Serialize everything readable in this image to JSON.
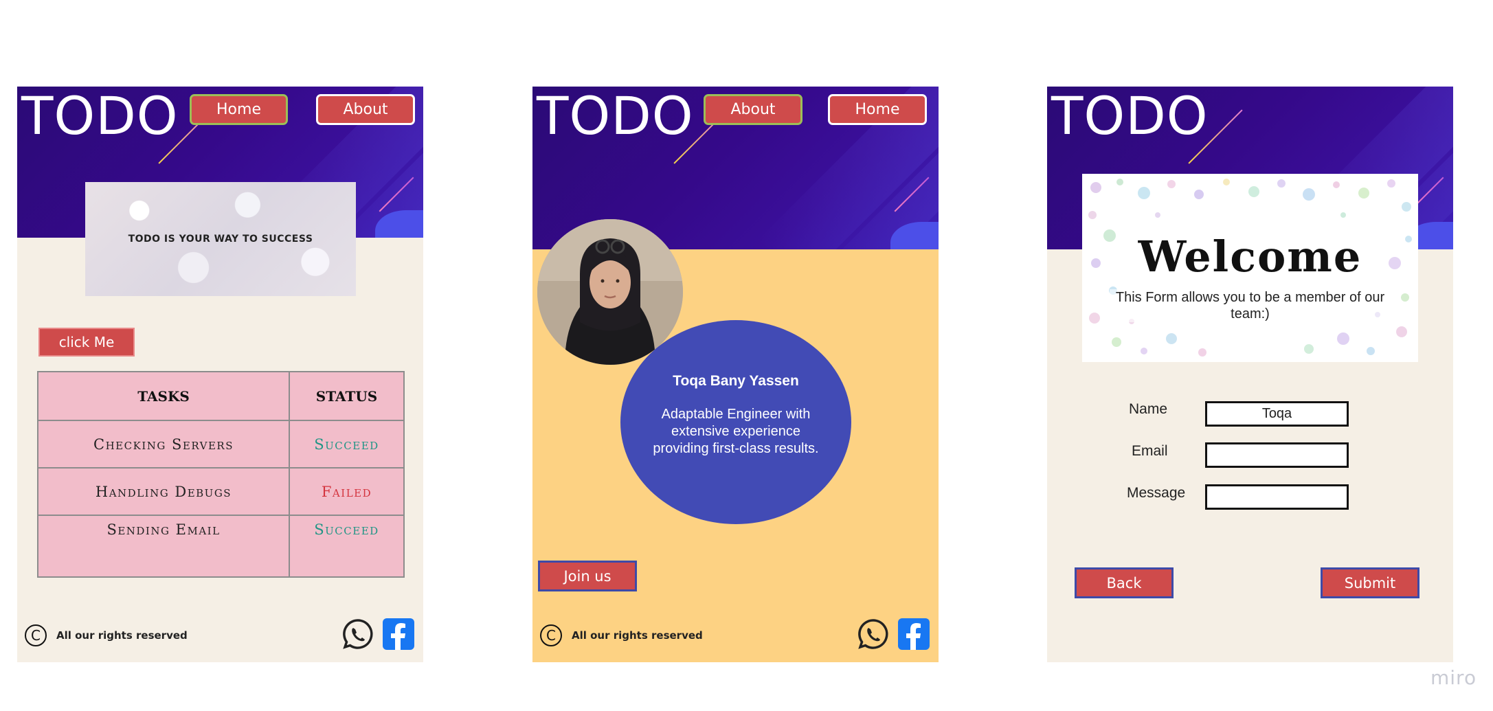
{
  "brand": {
    "logo": "TODO",
    "accent": "#cf4b4b",
    "header_color": "#35098a"
  },
  "home_page": {
    "nav": {
      "home": "Home",
      "about": "About"
    },
    "hero_text": "TODO IS YOUR WAY TO SUCCESS",
    "click_button": "click Me",
    "table": {
      "headers": [
        "TASKS",
        "STATUS"
      ],
      "rows": [
        {
          "task": "Checking Servers",
          "status": "Succeed"
        },
        {
          "task": "Handling Debugs",
          "status": "Failed"
        },
        {
          "task": "Sending Email",
          "status": "Succeed"
        }
      ]
    },
    "footer": {
      "copyright_symbol": "C",
      "rights": "All our rights reserved",
      "icons": [
        "whatsapp-icon",
        "facebook-icon"
      ]
    }
  },
  "about_page": {
    "nav": {
      "about": "About",
      "home": "Home"
    },
    "profile": {
      "name": "Toqa Bany Yassen",
      "description": "Adaptable Engineer with extensive experience providing first-class results."
    },
    "join_button": "Join us",
    "footer": {
      "copyright_symbol": "C",
      "rights": "All our rights reserved"
    }
  },
  "form_page": {
    "welcome_title": "Welcome",
    "welcome_subtitle": "This Form allows you to be a member of our team:)",
    "fields": {
      "name": {
        "label": "Name",
        "value": "Toqa"
      },
      "email": {
        "label": "Email",
        "value": ""
      },
      "message": {
        "label": "Message",
        "value": ""
      }
    },
    "back_button": "Back",
    "submit_button": "Submit"
  },
  "watermark": "miro"
}
